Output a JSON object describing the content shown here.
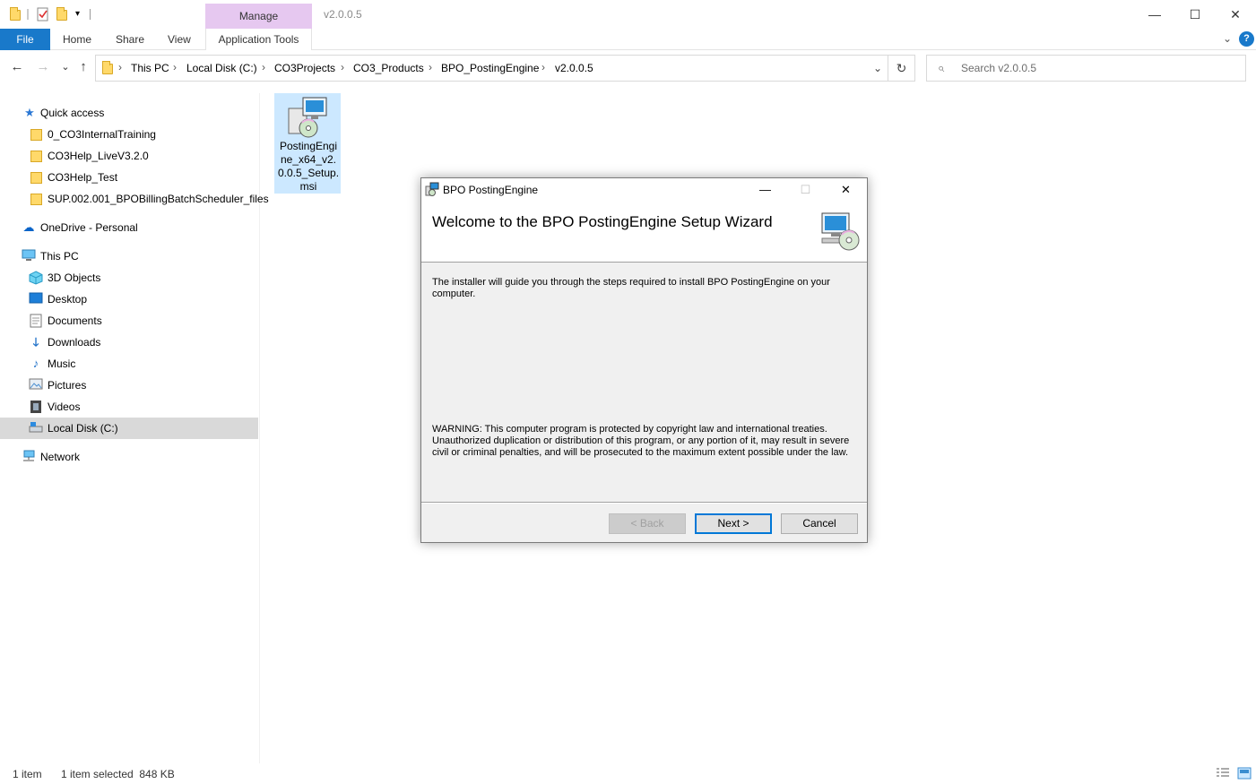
{
  "window": {
    "title": "v2.0.0.5",
    "context_tab": "Manage",
    "caption": {
      "minimize": "—",
      "maximize": "☐",
      "close": "✕"
    }
  },
  "ribbon": {
    "tabs": [
      {
        "label": "File"
      },
      {
        "label": "Home"
      },
      {
        "label": "Share"
      },
      {
        "label": "View"
      },
      {
        "label": "Application Tools"
      }
    ],
    "expand_glyph": "⌄",
    "help_glyph": "?"
  },
  "address": {
    "breadcrumbs": [
      "This PC",
      "Local Disk (C:)",
      "CO3Projects",
      "CO3_Products",
      "BPO_PostingEngine",
      "v2.0.0.5"
    ],
    "separator": "›",
    "back_glyph": "←",
    "forward_glyph": "→",
    "recent_glyph": "⌄",
    "up_glyph": "↑",
    "dropdown_glyph": "⌄",
    "refresh_glyph": "↻"
  },
  "search": {
    "placeholder": "Search v2.0.0.5",
    "icon_glyph": "⌕"
  },
  "navpane": {
    "quick_access": "Quick access",
    "pinned": [
      "0_CO3InternalTraining",
      "CO3Help_LiveV3.2.0",
      "CO3Help_Test",
      "SUP.002.001_BPOBillingBatchScheduler_files"
    ],
    "onedrive": "OneDrive - Personal",
    "this_pc": "This PC",
    "pc_items": [
      "3D Objects",
      "Desktop",
      "Documents",
      "Downloads",
      "Music",
      "Pictures",
      "Videos",
      "Local Disk (C:)"
    ],
    "network": "Network"
  },
  "content": {
    "file_name": "PostingEngine_x64_v2.0.0.5_Setup.msi"
  },
  "dialog": {
    "title": "BPO PostingEngine",
    "heading": "Welcome to the BPO PostingEngine Setup Wizard",
    "intro": "The installer will guide you through the steps required to install BPO PostingEngine on your computer.",
    "warning": "WARNING: This computer program is protected by copyright law and international treaties. Unauthorized duplication or distribution of this program, or any portion of it, may result in severe civil or criminal penalties, and will be prosecuted to the maximum extent possible under the law.",
    "buttons": {
      "back": "< Back",
      "next": "Next >",
      "cancel": "Cancel"
    },
    "caption": {
      "minimize": "—",
      "maximize": "☐",
      "close": "✕"
    }
  },
  "status": {
    "item_count": "1 item",
    "selection": "1 item selected  848 KB"
  },
  "colors": {
    "accent": "#1979ca",
    "manage_tab": "#e6c8f0",
    "selection": "#cce8ff",
    "nav_selected": "#d9d9d9"
  }
}
